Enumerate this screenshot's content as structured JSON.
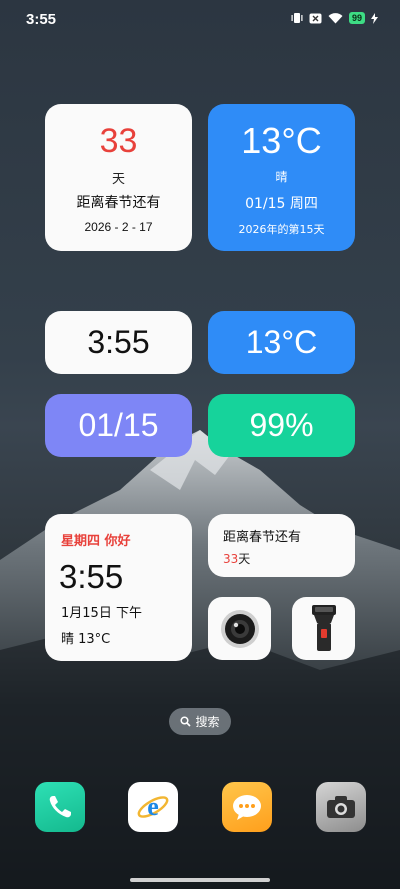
{
  "status_bar": {
    "time": "3:55",
    "battery": "99"
  },
  "countdown_widget": {
    "days": "33",
    "unit": "天",
    "label": "距离春节还有",
    "target_date": "2026 - 2 - 17"
  },
  "weather_widget": {
    "temperature": "13°C",
    "condition": "晴",
    "month_day": "01/15 周四",
    "year_day": "2026年的第15天"
  },
  "pills": {
    "time": "3:55",
    "temperature": "13°C",
    "date": "01/15",
    "battery": "99%"
  },
  "clock_widget": {
    "greeting": "星期四 你好",
    "time": "3:55",
    "date": "1月15日 下午",
    "weather": "晴 13°C"
  },
  "spring_widget": {
    "title": "距离春节还有",
    "days_number": "33",
    "days_unit": "天"
  },
  "search": {
    "label": "搜索"
  },
  "colors": {
    "accent_red": "#e8413b",
    "blue": "#2f8cf7",
    "purple": "#7e86f6",
    "green": "#16d39b"
  },
  "dock": [
    {
      "name": "phone-icon"
    },
    {
      "name": "browser-icon"
    },
    {
      "name": "messages-icon"
    },
    {
      "name": "camera-icon"
    }
  ]
}
